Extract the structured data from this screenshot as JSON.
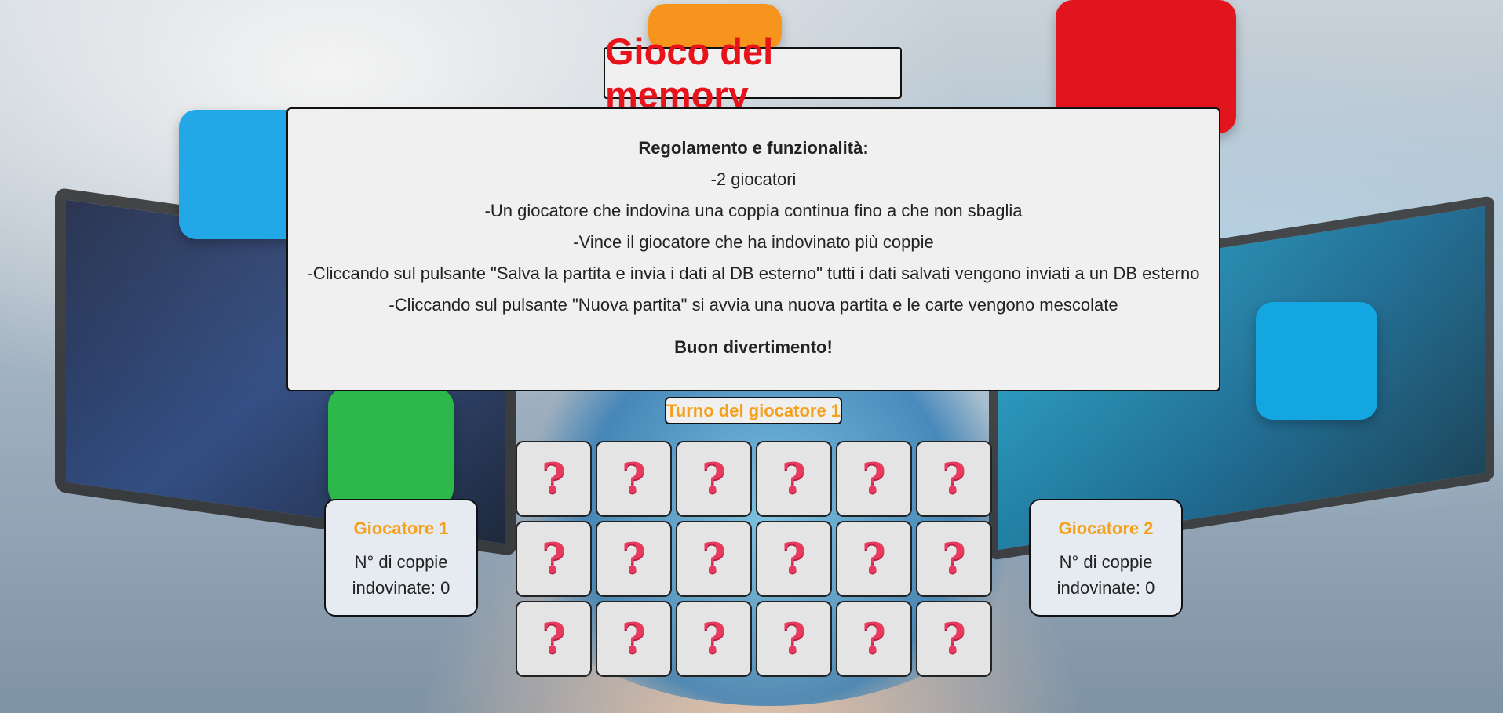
{
  "title": "Gioco del memory",
  "rules": {
    "heading": "Regolamento e funzionalità:",
    "lines": [
      "-2 giocatori",
      "-Un giocatore che indovina una coppia continua fino a che non sbaglia",
      "-Vince il giocatore che ha indovinato più coppie",
      "-Cliccando sul pulsante \"Salva la partita e invia i dati al DB esterno\" tutti i dati salvati vengono inviati a un DB esterno",
      "-Cliccando sul pulsante \"Nuova partita\" si avvia una nuova partita e le carte vengono mescolate"
    ],
    "closing": "Buon divertimento!"
  },
  "turn": "Turno del giocatore 1",
  "board": {
    "rows": 3,
    "cols": 6,
    "card_face": "❓",
    "icon": "question-mark-icon"
  },
  "players": [
    {
      "name": "Giocatore 1",
      "score_label": "N° di coppie indovinate: 0"
    },
    {
      "name": "Giocatore 2",
      "score_label": "N° di coppie indovinate: 0"
    }
  ],
  "colors": {
    "title": "#e8121a",
    "accent": "#f5a01a",
    "card_bg": "#e4e4e4",
    "question": "#e83a5c"
  }
}
